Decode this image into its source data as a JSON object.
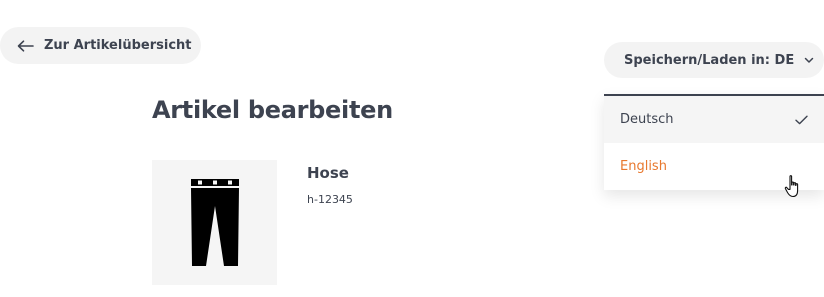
{
  "header": {
    "back_label": "Zur Artikelübersicht",
    "title": "Artikel bearbeiten"
  },
  "product": {
    "name": "Hose",
    "sku": "h-12345",
    "image_icon": "trousers-icon"
  },
  "language_selector": {
    "label": "Speichern/Laden in: DE",
    "options": [
      {
        "label": "Deutsch",
        "selected": true
      },
      {
        "label": "English",
        "selected": false,
        "hovered": true
      }
    ]
  },
  "colors": {
    "text": "#3d4350",
    "accent": "#e8782e",
    "surface": "#f3f3f3"
  }
}
